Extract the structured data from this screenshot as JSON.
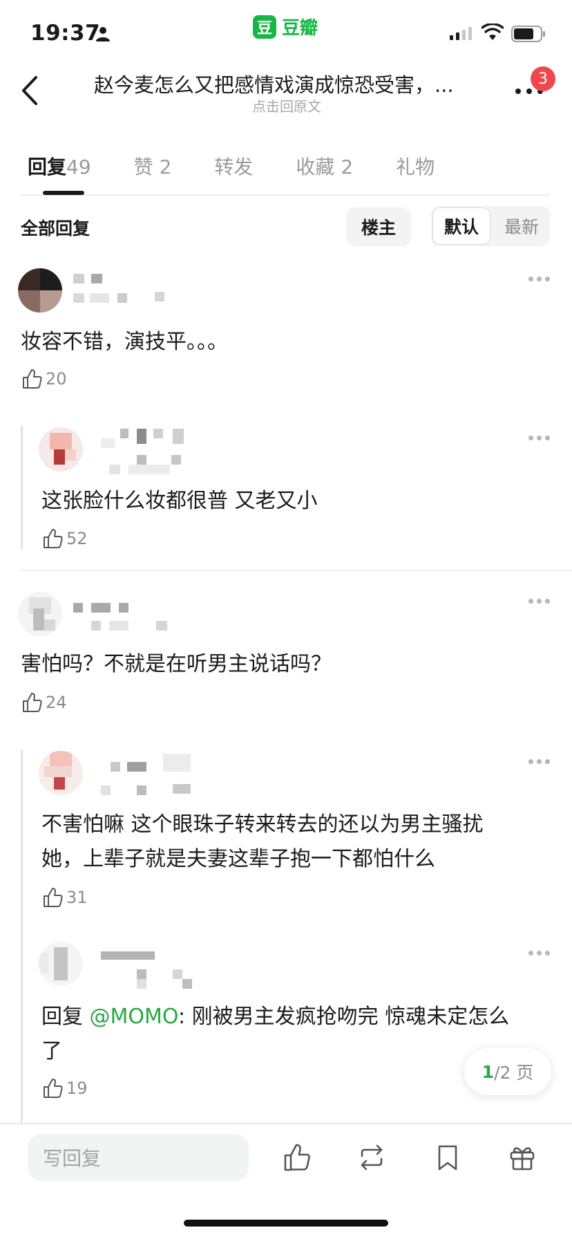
{
  "status": {
    "time": "19:37"
  },
  "app": {
    "name": "豆瓣",
    "logo_char": "豆",
    "brand_color": "#17b646"
  },
  "header": {
    "title": "赵今麦怎么又把感情戏演成惊恐受害，...",
    "subtitle": "点击回原文",
    "notification_count": "3"
  },
  "tabs": [
    {
      "label": "回复",
      "count": "49"
    },
    {
      "label": "赞",
      "count": "2"
    },
    {
      "label": "转发",
      "count": ""
    },
    {
      "label": "收藏",
      "count": "2"
    },
    {
      "label": "礼物",
      "count": ""
    }
  ],
  "filter": {
    "all_label": "全部回复",
    "op_label": "楼主",
    "sort_default": "默认",
    "sort_new": "最新"
  },
  "comments": [
    {
      "text": "妆容不错，演技平。。。",
      "likes": "20"
    },
    {
      "text": "这张脸什么妆都很普 又老又小",
      "likes": "52"
    },
    {
      "text": "害怕吗？不就是在听男主说话吗？",
      "likes": "24"
    },
    {
      "text_line1": "不害怕嘛 这个眼珠子转来转去的还以为男主骚扰",
      "text_line2": "她，上辈子就是夫妻这辈子抱一下都怕什么",
      "likes": "31"
    },
    {
      "reply_prefix": "回复 ",
      "mention": "@MOMO",
      "text_line1_rest": ": 刚被男主发疯抢吻完 惊魂未定怎么",
      "text_line2": "了",
      "likes": "19"
    }
  ],
  "pager": {
    "current": "1",
    "total_text": "/2 页"
  },
  "bottom": {
    "reply_placeholder": "写回复"
  },
  "colors": {
    "accent_green": "#27a844",
    "badge_red": "#f0474f"
  }
}
